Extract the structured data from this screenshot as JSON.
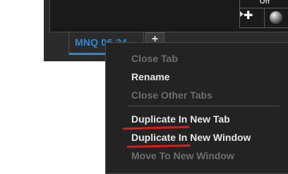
{
  "window": {
    "panel_header_text": "Off"
  },
  "tab_strip": {
    "active_tab_label": "MNQ 06-24",
    "add_tab_label": "+"
  },
  "context_menu": {
    "items": [
      {
        "label": "Close Tab",
        "enabled": false
      },
      {
        "label": "Rename",
        "enabled": true
      },
      {
        "label": "Close Other Tabs",
        "enabled": false
      },
      {
        "label": "Duplicate In New Tab",
        "enabled": true
      },
      {
        "label": "Duplicate In New Window",
        "enabled": true
      },
      {
        "label": "Move To New Window",
        "enabled": false
      }
    ]
  },
  "colors": {
    "accent": "#2f86d6",
    "menu_background": "#232323",
    "annotation": "#e01b1b"
  }
}
